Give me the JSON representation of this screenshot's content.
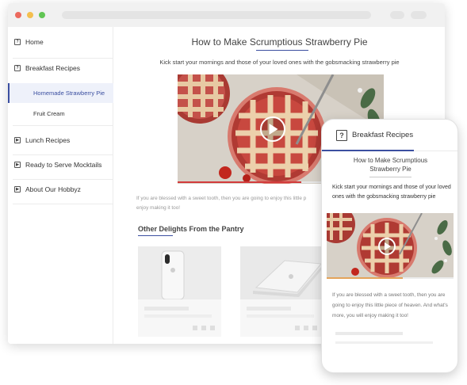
{
  "sidebar": {
    "items": [
      {
        "label": "Home",
        "icon": "question-icon"
      },
      {
        "label": "Breakfast Recipes",
        "icon": "question-icon"
      },
      {
        "label": "Lunch Recipes",
        "icon": "video-icon"
      },
      {
        "label": "Ready to Serve Mocktails",
        "icon": "video-icon"
      },
      {
        "label": "About Our Hobbyz",
        "icon": "video-icon"
      }
    ],
    "subitems": [
      {
        "label": "Homemade Strawberry Pie",
        "active": true
      },
      {
        "label": "Fruit Cream",
        "active": false
      }
    ]
  },
  "main": {
    "title": "How to Make Scrumptious Strawberry Pie",
    "subtitle": "Kick start your mornings and those of your loved ones with the gobsmacking strawberry pie",
    "body": "If you are blessed with a sweet tooth, then you are going to enjoy this little p",
    "body_line2": "enjoy making it too!",
    "video_progress": 0.6,
    "other_title": "Other Delights From the Pantry"
  },
  "phone": {
    "header": "Breakfast Recipes",
    "title_line1": "How to Make Scrumptious",
    "title_line2": "Strawberry Pie",
    "subtitle": "Kick start your mornings and those of your loved ones with the gobsmacking strawberry pie",
    "body": "If you are blessed with a sweet tooth, then you are going to enjoy this little piece of heaven. And what's more, you will enjoy making it too!",
    "video_progress": 0.6
  },
  "colors": {
    "accent": "#3b4fa0",
    "progress_red": "#d23b3b",
    "progress_orange": "#e4a35a",
    "dot_red": "#ec6a5e",
    "dot_yellow": "#f4bf4f",
    "dot_green": "#61c554"
  }
}
